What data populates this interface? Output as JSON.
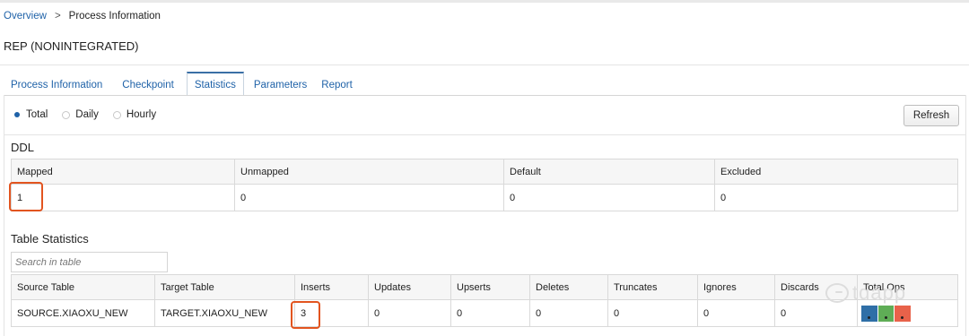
{
  "breadcrumb": {
    "root": "Overview",
    "separator": ">",
    "current": "Process Information"
  },
  "page_title": "REP (NONINTEGRATED)",
  "tabs": [
    {
      "label": "Process Information",
      "active": false
    },
    {
      "label": "Checkpoint",
      "active": false
    },
    {
      "label": "Statistics",
      "active": true
    },
    {
      "label": "Parameters",
      "active": false
    },
    {
      "label": "Report",
      "active": false
    }
  ],
  "period_options": [
    {
      "label": "Total",
      "checked": true
    },
    {
      "label": "Daily",
      "checked": false
    },
    {
      "label": "Hourly",
      "checked": false
    }
  ],
  "refresh_label": "Refresh",
  "ddl": {
    "title": "DDL",
    "headers": [
      "Mapped",
      "Unmapped",
      "Default",
      "Excluded"
    ],
    "values": [
      "1",
      "0",
      "0",
      "0"
    ]
  },
  "table_stats": {
    "title": "Table Statistics",
    "search_placeholder": "Search in table",
    "headers": [
      "Source Table",
      "Target Table",
      "Inserts",
      "Updates",
      "Upserts",
      "Deletes",
      "Truncates",
      "Ignores",
      "Discards",
      "Total Ops"
    ],
    "rows": [
      {
        "source": "SOURCE.XIAOXU_NEW",
        "target": "TARGET.XIAOXU_NEW",
        "inserts": "3",
        "updates": "0",
        "upserts": "0",
        "deletes": "0",
        "truncates": "0",
        "ignores": "0",
        "discards": "0"
      }
    ],
    "swatch_colors": [
      "#2f6fa7",
      "#5fad56",
      "#e8624a"
    ]
  },
  "highlight_color": "#e2541f",
  "watermark_text": "tdapp"
}
